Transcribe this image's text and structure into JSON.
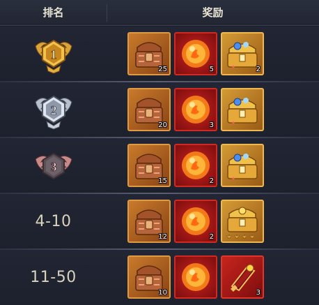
{
  "header": {
    "rank_label": "排名",
    "reward_label": "奖励"
  },
  "rows": [
    {
      "rank": "1",
      "badge": "gold-rank-badge-icon",
      "rewards": [
        {
          "type": "bronze-chest",
          "qty": "25"
        },
        {
          "type": "fire-orb",
          "qty": "5"
        },
        {
          "type": "gold-treasure-chest",
          "qty": "2"
        }
      ]
    },
    {
      "rank": "2",
      "badge": "silver-rank-badge-icon",
      "rewards": [
        {
          "type": "bronze-chest",
          "qty": "20"
        },
        {
          "type": "fire-orb",
          "qty": "3"
        },
        {
          "type": "gold-treasure-chest",
          "qty": ""
        }
      ]
    },
    {
      "rank": "3",
      "badge": "bronze-rank-badge-icon",
      "rewards": [
        {
          "type": "bronze-chest",
          "qty": "15"
        },
        {
          "type": "fire-orb",
          "qty": "2"
        },
        {
          "type": "gold-treasure-chest",
          "qty": ""
        }
      ]
    },
    {
      "rank": "4-10",
      "rewards": [
        {
          "type": "bronze-chest",
          "qty": "12"
        },
        {
          "type": "fire-orb",
          "qty": "2"
        },
        {
          "type": "gold-treasure-chest-stars",
          "qty": ""
        }
      ]
    },
    {
      "rank": "11-50",
      "rewards": [
        {
          "type": "bronze-chest",
          "qty": "10"
        },
        {
          "type": "fire-orb",
          "qty": ""
        },
        {
          "type": "crimson-relic",
          "qty": "3"
        }
      ]
    }
  ]
}
